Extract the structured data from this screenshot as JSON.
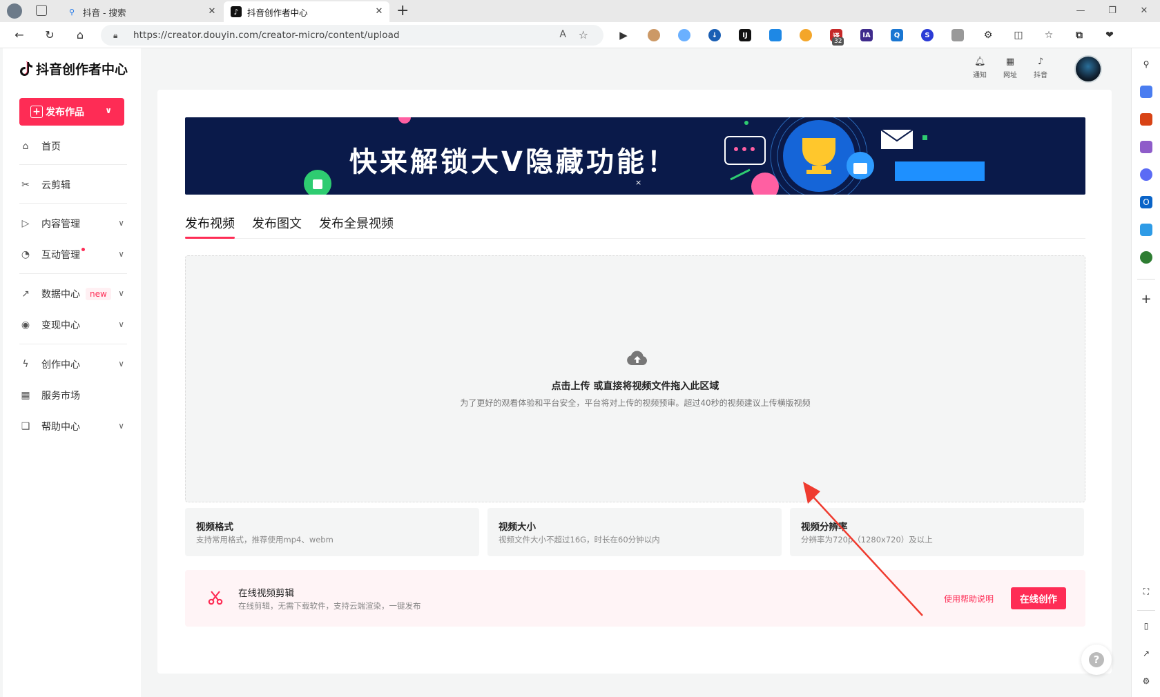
{
  "browser": {
    "tabs": [
      {
        "title": "抖音 - 搜索",
        "active": false
      },
      {
        "title": "抖音创作者中心",
        "active": true
      }
    ],
    "new_tab": "+",
    "url": "https://creator.douyin.com/creator-micro/content/upload",
    "extension_badge": "32"
  },
  "brand": {
    "title": "抖音创作者中心"
  },
  "sidebar": {
    "publish_button": "发布作品",
    "items": [
      {
        "label": "首页",
        "icon": "home-icon"
      },
      {
        "label": "云剪辑",
        "icon": "scissors-icon"
      },
      {
        "label": "内容管理",
        "icon": "content-icon",
        "expandable": true
      },
      {
        "label": "互动管理",
        "icon": "interaction-icon",
        "expandable": true,
        "dot": true
      },
      {
        "label": "数据中心",
        "icon": "chart-icon",
        "expandable": true,
        "tag": "new"
      },
      {
        "label": "变现中心",
        "icon": "monetize-icon",
        "expandable": true
      },
      {
        "label": "创作中心",
        "icon": "bolt-icon",
        "expandable": true
      },
      {
        "label": "服务市场",
        "icon": "store-icon"
      },
      {
        "label": "帮助中心",
        "icon": "book-icon",
        "expandable": true
      }
    ]
  },
  "header": {
    "notify": "通知",
    "sites": "网址",
    "douyin": "抖音"
  },
  "banner": {
    "headline": "快来解锁大V隐藏功能！",
    "close": "×"
  },
  "tabs": [
    "发布视频",
    "发布图文",
    "发布全景视频"
  ],
  "upload": {
    "title": "点击上传 或直接将视频文件拖入此区域",
    "subtitle": "为了更好的观看体验和平台安全，平台将对上传的视频预审。超过40秒的视频建议上传横版视频"
  },
  "specs": [
    {
      "title": "视频格式",
      "desc": "支持常用格式，推荐使用mp4、webm"
    },
    {
      "title": "视频大小",
      "desc": "视频文件大小不超过16G，时长在60分钟以内"
    },
    {
      "title": "视频分辨率",
      "desc": "分辨率为720p（1280x720）及以上"
    }
  ],
  "online_edit": {
    "title": "在线视频剪辑",
    "desc": "在线剪辑，无需下载软件，支持云端渲染，一键发布",
    "help_link": "使用帮助说明",
    "button": "在线创作"
  },
  "help_fab": "?",
  "colors": {
    "accent": "#fe2c55",
    "banner_bg": "#0a1a4a",
    "annotation_arrow": "#ef3b2f"
  }
}
